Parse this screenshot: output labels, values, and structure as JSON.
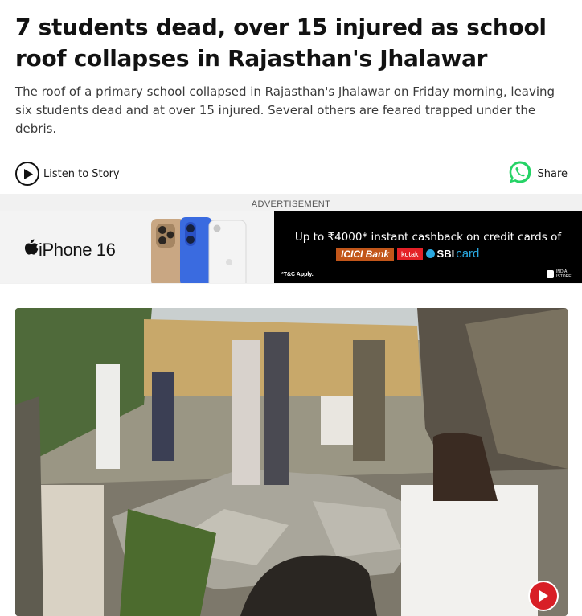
{
  "article": {
    "headline": "7 students dead, over 15 injured as school roof collapses in Rajasthan's Jhalawar",
    "summary": "The roof of a primary school collapsed in Rajasthan's Jhalawar on Friday morning, leaving six students dead and at over 15 injured. Several others are feared trapped under the debris."
  },
  "actions": {
    "listen_label": "Listen to Story",
    "listen_icon": "play-circle-icon",
    "share_label": "Share",
    "share_icon": "whatsapp-icon",
    "share_color": "#25d366"
  },
  "advertisement": {
    "label": "ADVERTISEMENT",
    "product": "iPhone 16",
    "product_icon": "apple-icon",
    "offer": "Up to ₹4000* instant cashback on credit cards of",
    "banks": [
      "ICICI Bank",
      "kotak",
      "SBI",
      "card"
    ],
    "tnc": "*T&C Apply.",
    "store": [
      "INDIA",
      "ISTORE"
    ]
  },
  "video": {
    "play_icon": "play-icon",
    "play_color": "#d81f26"
  }
}
